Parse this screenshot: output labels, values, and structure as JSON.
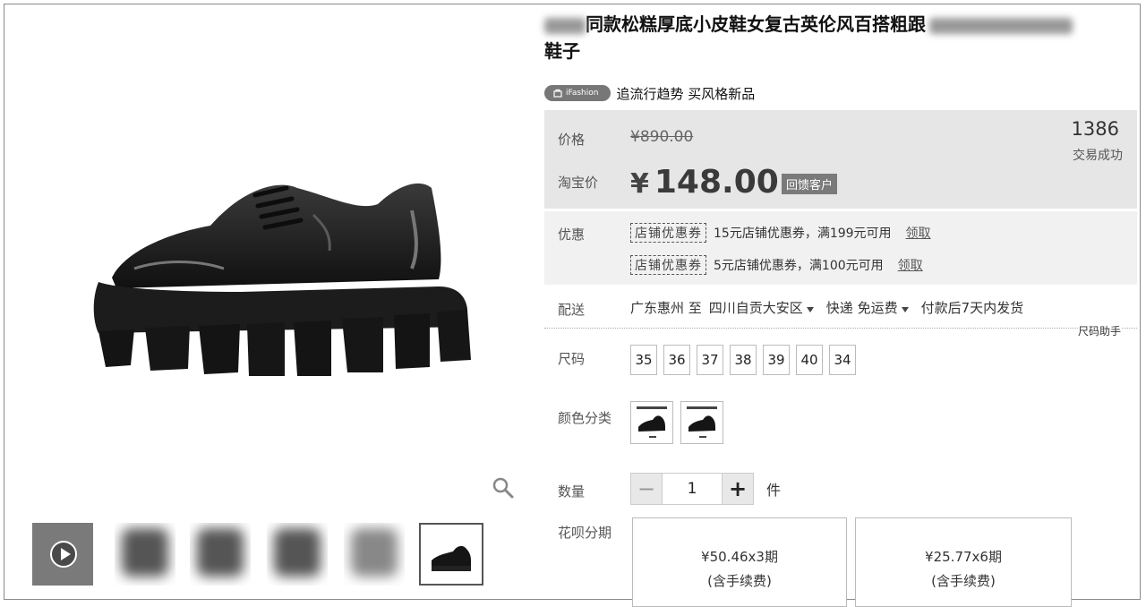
{
  "product": {
    "title_line1": "同款松糕厚底小皮鞋女复古英伦风百搭粗跟",
    "title_line2": "鞋子",
    "badge_label": "iFashion",
    "tagline": "追流行趋势 买风格新品"
  },
  "price": {
    "label": "价格",
    "original": "¥890.00",
    "taobao_label": "淘宝价",
    "currency": "¥",
    "current": "148.00",
    "reward_tag": "回馈客户",
    "sold_count": "1386",
    "sold_label": "交易成功"
  },
  "promo": {
    "label": "优惠",
    "coupons": [
      {
        "tag": "店铺优惠券",
        "text": "15元店铺优惠券，满199元可用",
        "action": "领取"
      },
      {
        "tag": "店铺优惠券",
        "text": "5元店铺优惠券，满100元可用",
        "action": "领取"
      }
    ]
  },
  "shipping": {
    "label": "配送",
    "from": "广东惠州 至",
    "to": "四川自贡大安区",
    "method": "快递 免运费",
    "dispatch": "付款后7天内发货"
  },
  "size": {
    "label": "尺码",
    "helper": "尺码助手",
    "options": [
      "35",
      "36",
      "37",
      "38",
      "39",
      "40",
      "34"
    ]
  },
  "color": {
    "label": "颜色分类"
  },
  "quantity": {
    "label": "数量",
    "minus": "−",
    "value": "1",
    "plus": "+",
    "unit": "件"
  },
  "installments": {
    "label": "花呗分期",
    "plans": [
      {
        "amount": "¥50.46x3期",
        "fee": "(含手续费)"
      },
      {
        "amount": "¥25.77x6期",
        "fee": "(含手续费)"
      }
    ]
  },
  "icons": {
    "zoom": "magnifier-icon",
    "play": "play-icon"
  },
  "colors": {
    "price_bg": "#e6e6e6",
    "promo_bg": "#f1f1f1",
    "badge_bg": "#777777"
  }
}
